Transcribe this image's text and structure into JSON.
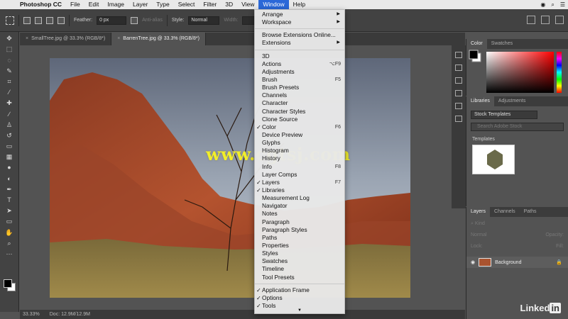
{
  "menubar": {
    "app": "Photoshop CC",
    "items": [
      "File",
      "Edit",
      "Image",
      "Layer",
      "Type",
      "Select",
      "Filter",
      "3D",
      "View",
      "Window",
      "Help"
    ],
    "active": "Window"
  },
  "optbar": {
    "feather_label": "Feather:",
    "feather_value": "0 px",
    "antialias_label": "Anti-alias",
    "style_label": "Style:",
    "style_value": "Normal",
    "width_label": "Width:"
  },
  "tabs": [
    {
      "label": "SmallTree.jpg @ 33.3% (RGB/8*)",
      "active": false
    },
    {
      "label": "BarrenTree.jpg @ 33.3% (RGB/8*)",
      "active": true
    }
  ],
  "status": {
    "zoom": "33.33%",
    "doc": "Doc: 12.9M/12.9M"
  },
  "watermark": "www.cgtsj.com",
  "window_menu": {
    "group1": [
      {
        "label": "Arrange",
        "submenu": true
      },
      {
        "label": "Workspace",
        "submenu": true
      }
    ],
    "group2": [
      {
        "label": "Browse Extensions Online..."
      },
      {
        "label": "Extensions",
        "submenu": true
      }
    ],
    "group3": [
      {
        "label": "3D"
      },
      {
        "label": "Actions",
        "shortcut": "⌥F9"
      },
      {
        "label": "Adjustments"
      },
      {
        "label": "Brush",
        "shortcut": "F5"
      },
      {
        "label": "Brush Presets"
      },
      {
        "label": "Channels"
      },
      {
        "label": "Character"
      },
      {
        "label": "Character Styles"
      },
      {
        "label": "Clone Source"
      },
      {
        "label": "Color",
        "shortcut": "F6",
        "checked": true
      },
      {
        "label": "Device Preview"
      },
      {
        "label": "Glyphs"
      },
      {
        "label": "Histogram"
      },
      {
        "label": "History"
      },
      {
        "label": "Info",
        "shortcut": "F8"
      },
      {
        "label": "Layer Comps"
      },
      {
        "label": "Layers",
        "shortcut": "F7",
        "checked": true
      },
      {
        "label": "Libraries",
        "checked": true
      },
      {
        "label": "Measurement Log"
      },
      {
        "label": "Navigator"
      },
      {
        "label": "Notes"
      },
      {
        "label": "Paragraph"
      },
      {
        "label": "Paragraph Styles"
      },
      {
        "label": "Paths"
      },
      {
        "label": "Properties"
      },
      {
        "label": "Styles"
      },
      {
        "label": "Swatches"
      },
      {
        "label": "Timeline"
      },
      {
        "label": "Tool Presets"
      }
    ],
    "group4": [
      {
        "label": "Application Frame",
        "checked": true
      },
      {
        "label": "Options",
        "checked": true
      },
      {
        "label": "Tools",
        "checked": true
      }
    ]
  },
  "color_panel": {
    "tabs": [
      "Color",
      "Swatches"
    ]
  },
  "libraries_panel": {
    "tabs": [
      "Libraries",
      "Adjustments"
    ],
    "library_name": "Stock Templates",
    "search_placeholder": "Search Adobe Stock",
    "section": "Templates"
  },
  "layers_panel": {
    "tabs": [
      "Layers",
      "Channels",
      "Paths"
    ],
    "kind_label": "Kind",
    "blend_mode": "Normal",
    "opacity_label": "Opacity:",
    "lock_label": "Lock:",
    "fill_label": "Fill:",
    "layer_name": "Background"
  },
  "brand": {
    "linked": "Linked",
    "in": "in"
  }
}
